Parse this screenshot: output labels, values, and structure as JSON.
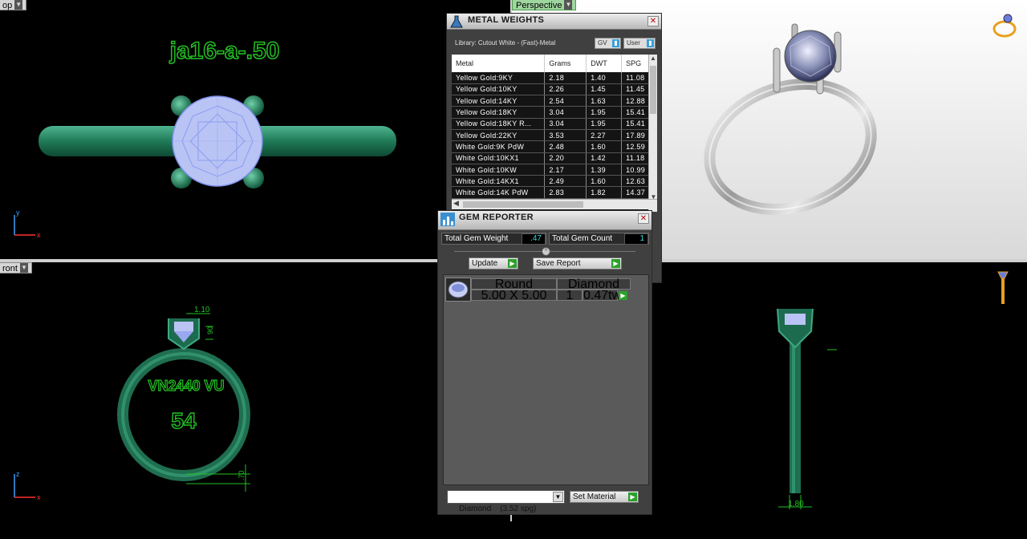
{
  "viewports": {
    "top": {
      "label": "op",
      "annotation": "ja16-a-.50"
    },
    "perspective": {
      "label": "Perspective"
    },
    "front": {
      "label": "ront",
      "engrave1": "VN2440 VU",
      "engrave2": "54",
      "dim_top": "1.10",
      "dim_side": "90",
      "dim_bottom": ".70"
    },
    "right": {
      "dim_bottom": "1.80"
    }
  },
  "axis": {
    "x": "x",
    "y": "y",
    "z": "z"
  },
  "metal_weights": {
    "title": "METAL WEIGHTS",
    "library": "Library: Cutout White - (Fast)-Metal",
    "gv_label": "GV",
    "user_label": "User",
    "columns": [
      "Metal",
      "Grams",
      "DWT",
      "SPG"
    ],
    "rows": [
      [
        "Yellow Gold:9KY",
        "2.18",
        "1.40",
        "11.08"
      ],
      [
        "Yellow Gold:10KY",
        "2.26",
        "1.45",
        "11.45"
      ],
      [
        "Yellow Gold:14KY",
        "2.54",
        "1.63",
        "12.88"
      ],
      [
        "Yellow Gold:18KY",
        "3.04",
        "1.95",
        "15.41"
      ],
      [
        "Yellow Gold:18KY R...",
        "3.04",
        "1.95",
        "15.41"
      ],
      [
        "Yellow Gold:22KY",
        "3.53",
        "2.27",
        "17.89"
      ],
      [
        "White Gold:9K PdW",
        "2.48",
        "1.60",
        "12.59"
      ],
      [
        "White Gold:10KX1",
        "2.20",
        "1.42",
        "11.18"
      ],
      [
        "White Gold:10KW",
        "2.17",
        "1.39",
        "10.99"
      ],
      [
        "White Gold:14KX1",
        "2.49",
        "1.60",
        "12.63"
      ],
      [
        "White Gold:14K PdW",
        "2.83",
        "1.82",
        "14.37"
      ]
    ]
  },
  "gem_reporter": {
    "title": "GEM REPORTER",
    "total_weight_label": "Total Gem Weight",
    "total_weight_value": ".47",
    "total_count_label": "Total Gem Count",
    "total_count_value": "1",
    "update_label": "Update",
    "save_label": "Save Report",
    "gem": {
      "shape": "Round",
      "type": "Diamond",
      "size": "5.00 X 5.00",
      "count": "1",
      "weight": "0.47tw"
    },
    "material_select": "Diamond    (3.52 spg)",
    "set_material_label": "Set Material"
  },
  "colors": {
    "model_green": "#2e8b6a",
    "annotation_green": "#22c022",
    "gem_blue": "#b9c4f5"
  }
}
